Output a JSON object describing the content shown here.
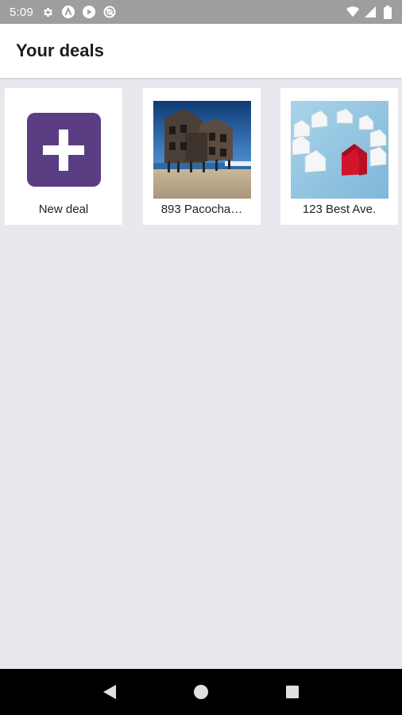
{
  "status_bar": {
    "time": "5:09",
    "left_icons": [
      "settings-icon",
      "a-circle-icon",
      "play-circle-icon",
      "no-data-icon"
    ],
    "right_icons": [
      "wifi-icon",
      "cell-signal-icon",
      "battery-icon"
    ]
  },
  "app_bar": {
    "title": "Your deals"
  },
  "deals": [
    {
      "label": "New deal",
      "icon": "plus-icon",
      "accent": "#5a3d82"
    },
    {
      "label": "893 Pacocha…",
      "image": "weathered-beach-house-photo"
    },
    {
      "label": "123 Best Ave.",
      "image": "paper-houses-red-house-photo"
    }
  ],
  "nav_bar": {
    "buttons": [
      "back-icon",
      "home-icon",
      "recents-icon"
    ]
  },
  "colors": {
    "status_bar": "#9e9e9e",
    "background": "#e9e8ee",
    "accent": "#5a3d82",
    "nav_bar": "#000000"
  }
}
